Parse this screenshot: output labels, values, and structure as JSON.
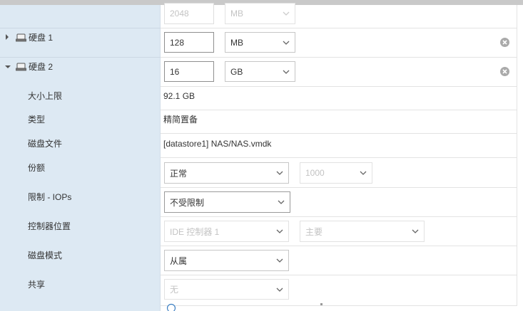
{
  "disks": [
    {
      "label": "硬盘 1",
      "size": "128",
      "unit": "MB",
      "expanded": false
    },
    {
      "label": "硬盘 2",
      "size": "16",
      "unit": "GB",
      "expanded": true
    }
  ],
  "partial_top_row": {
    "size": "2048",
    "unit": "MB"
  },
  "fields": {
    "max_size": {
      "label": "大小上限",
      "value": "92.1 GB"
    },
    "type": {
      "label": "类型",
      "value": "精简置备"
    },
    "disk_file": {
      "label": "磁盘文件",
      "value": "[datastore1] NAS/NAS.vmdk"
    },
    "shares": {
      "label": "份额",
      "value": "正常",
      "number": "1000"
    },
    "limit_iops": {
      "label": "限制 - IOPs",
      "value": "不受限制"
    },
    "controller": {
      "label": "控制器位置",
      "value": "IDE 控制器 1",
      "position": "主要"
    },
    "disk_mode": {
      "label": "磁盘模式",
      "value": "从属"
    },
    "sharing": {
      "label": "共享",
      "value": "无"
    }
  },
  "icons": {
    "expand_collapsed": "triangle-right-icon",
    "expand_open": "triangle-down-icon",
    "disk": "hard-disk-icon",
    "remove": "clear-circle-icon",
    "dropdown": "chevron-down-icon"
  },
  "colors": {
    "left_column": "#dde9f3",
    "topbar": "#c9c9c9",
    "disabled_text": "#c3c3c3",
    "row_divider": "#e3e3e3"
  }
}
